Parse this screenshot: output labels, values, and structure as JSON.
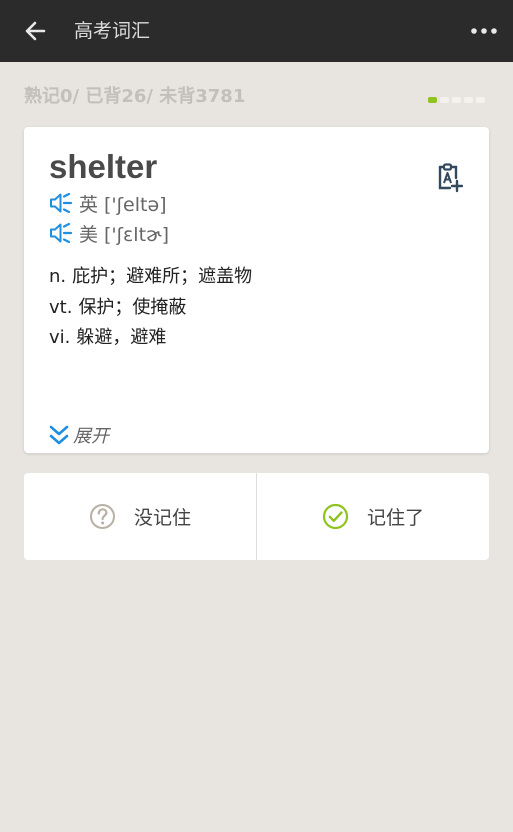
{
  "header": {
    "title": "高考词汇",
    "back_icon": "arrow-left-icon",
    "more_icon": "more-dots-icon"
  },
  "stats": {
    "text": "熟记0/ 已背26/ 未背3781",
    "mastered": 0,
    "learned": 26,
    "remaining": 3781
  },
  "progress": {
    "active_index": 0,
    "dot_count": 5,
    "active_color": "#8fc31f"
  },
  "card": {
    "word": "shelter",
    "pronunciations": [
      {
        "lang": "英",
        "phonetic": "['ʃeltə]"
      },
      {
        "lang": "美",
        "phonetic": "['ʃɛltɚ]"
      }
    ],
    "definitions": [
      {
        "pos": "n.",
        "meaning": "庇护；避难所；遮盖物"
      },
      {
        "pos": "vt.",
        "meaning": "保护；使掩蔽"
      },
      {
        "pos": "vi.",
        "meaning": "躲避，避难"
      }
    ],
    "expand_label": "展开",
    "accent_color": "#1e8fe1"
  },
  "answers": {
    "forgot_label": "没记住",
    "remembered_label": "记住了",
    "forgot_color": "#b8b0a4",
    "remembered_color": "#8fc31f"
  }
}
